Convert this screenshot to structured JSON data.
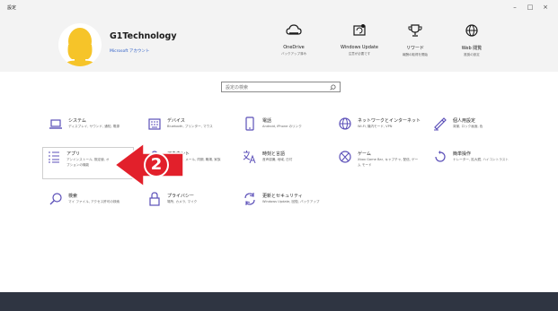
{
  "window": {
    "title": "設定",
    "controls": [
      "–",
      "□",
      "×"
    ]
  },
  "account": {
    "name": "G1Technology",
    "link": "Microsoft アカウント"
  },
  "header_items": [
    {
      "icon": "cloud-icon",
      "label": "OneDrive",
      "sub": "バックアップ済み"
    },
    {
      "icon": "windows-update-icon",
      "label": "Windows Update",
      "sub": "注意が必要です"
    },
    {
      "icon": "trophy-icon",
      "label": "リワード",
      "sub": "報酬の取得を開始"
    },
    {
      "icon": "globe-icon",
      "label": "Web 閲覧",
      "sub": "推奨の設定"
    }
  ],
  "search": {
    "placeholder": "設定の検索"
  },
  "categories": [
    {
      "icon": "laptop-icon",
      "title": "システム",
      "sub": "ディスプレイ, サウンド, 通知, 電源"
    },
    {
      "icon": "keyboard-icon",
      "title": "デバイス",
      "sub": "Bluetooth, プリンター, マウス"
    },
    {
      "icon": "phone-icon",
      "title": "電話",
      "sub": "Android, iPhone のリンク"
    },
    {
      "icon": "network-globe-icon",
      "title": "ネットワークとインターネット",
      "sub": "Wi-Fi, 機内モード, VPN"
    },
    {
      "icon": "paint-brush-icon",
      "title": "個人用設定",
      "sub": "背景, ロック画面, 色"
    },
    {
      "icon": "apps-list-icon",
      "title": "アプリ",
      "sub": "アンインストール, 既定値, オプションの機能"
    },
    {
      "icon": "person-icon",
      "title": "アカウント",
      "sub": "アカウント, メール, 同期, 職場, 家族"
    },
    {
      "icon": "language-icon",
      "title": "時刻と言語",
      "sub": "音声認識, 地域, 日付"
    },
    {
      "icon": "xbox-icon",
      "title": "ゲーム",
      "sub": "Xbox Game Bar, キャプチャ, 配信, ゲーム モード"
    },
    {
      "icon": "ease-of-access-icon",
      "title": "簡単操作",
      "sub": "ナレーター, 拡大鏡, ハイコントラスト"
    },
    {
      "icon": "search-icon",
      "title": "検索",
      "sub": "マイ ファイル, アクセス許可の検索"
    },
    {
      "icon": "lock-icon",
      "title": "プライバシー",
      "sub": "場所, カメラ, マイク"
    },
    {
      "icon": "sync-icon",
      "title": "更新とセキュリティ",
      "sub": "Windows Update, 回復, バックアップ"
    }
  ],
  "annotation": {
    "step": "2"
  },
  "colors": {
    "header_bg": "#f3f3f3",
    "accent_purple": "#5b4fb8",
    "arrow_red": "#e2202b",
    "footer": "#2f3542",
    "avatar_yellow": "#f6c429"
  }
}
